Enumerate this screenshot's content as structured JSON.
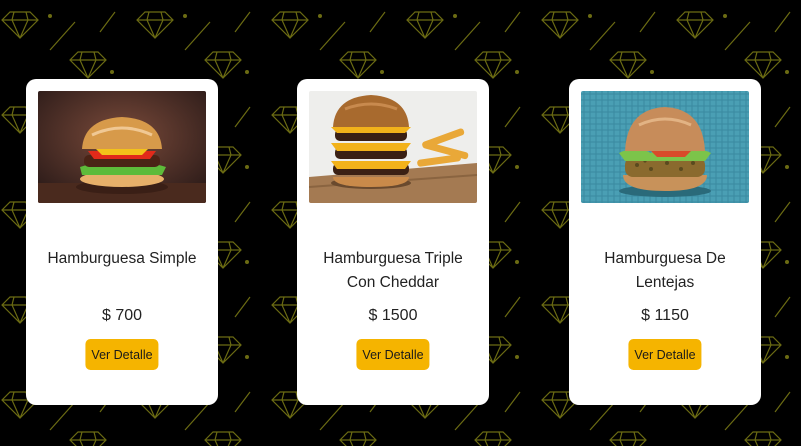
{
  "colors": {
    "background": "#000000",
    "pattern": "#6b6b12",
    "accent": "#f5b400",
    "card": "#ffffff"
  },
  "products": [
    {
      "name": "Hamburguesa Simple",
      "price": "$ 700",
      "button_label": "Ver Detalle",
      "image": "burger-simple-photo"
    },
    {
      "name": "Hamburguesa Triple Con Cheddar",
      "price": "$ 1500",
      "button_label": "Ver Detalle",
      "image": "burger-triple-cheddar-photo"
    },
    {
      "name": "Hamburguesa De Lentejas",
      "price": "$ 1150",
      "button_label": "Ver Detalle",
      "image": "burger-lentejas-photo"
    }
  ]
}
